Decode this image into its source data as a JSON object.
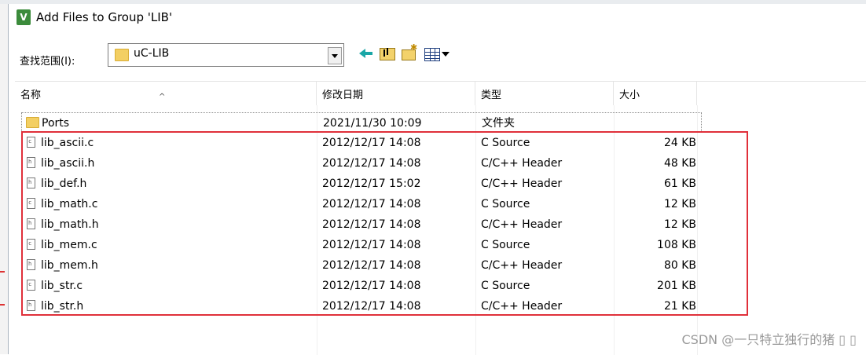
{
  "window": {
    "title": "Add Files to Group 'LIB'"
  },
  "toolbar": {
    "lookin_label": "查找范围(I):",
    "lookin_value": "uC-LIB",
    "icons": [
      "back-icon",
      "up-folder-icon",
      "new-folder-icon",
      "view-menu-icon"
    ]
  },
  "columns": [
    {
      "label": "名称"
    },
    {
      "label": "修改日期"
    },
    {
      "label": "类型"
    },
    {
      "label": "大小"
    }
  ],
  "files": [
    {
      "name": "Ports",
      "date": "2021/11/30 10:09",
      "type": "文件夹",
      "size": "",
      "icon": "folder-icon"
    },
    {
      "name": "lib_ascii.c",
      "date": "2012/12/17 14:08",
      "type": "C Source",
      "size": "24 KB",
      "icon": "c-file-icon"
    },
    {
      "name": "lib_ascii.h",
      "date": "2012/12/17 14:08",
      "type": "C/C++ Header",
      "size": "48 KB",
      "icon": "h-file-icon"
    },
    {
      "name": "lib_def.h",
      "date": "2012/12/17 15:02",
      "type": "C/C++ Header",
      "size": "61 KB",
      "icon": "h-file-icon"
    },
    {
      "name": "lib_math.c",
      "date": "2012/12/17 14:08",
      "type": "C Source",
      "size": "12 KB",
      "icon": "c-file-icon"
    },
    {
      "name": "lib_math.h",
      "date": "2012/12/17 14:08",
      "type": "C/C++ Header",
      "size": "12 KB",
      "icon": "h-file-icon"
    },
    {
      "name": "lib_mem.c",
      "date": "2012/12/17 14:08",
      "type": "C Source",
      "size": "108 KB",
      "icon": "c-file-icon"
    },
    {
      "name": "lib_mem.h",
      "date": "2012/12/17 14:08",
      "type": "C/C++ Header",
      "size": "80 KB",
      "icon": "h-file-icon"
    },
    {
      "name": "lib_str.c",
      "date": "2012/12/17 14:08",
      "type": "C Source",
      "size": "201 KB",
      "icon": "c-file-icon"
    },
    {
      "name": "lib_str.h",
      "date": "2012/12/17 14:08",
      "type": "C/C++ Header",
      "size": "21 KB",
      "icon": "h-file-icon"
    }
  ],
  "annotation": {
    "color": "#e0303a"
  },
  "watermark": "CSDN @一只特立独行的猪 ▯ ▯"
}
